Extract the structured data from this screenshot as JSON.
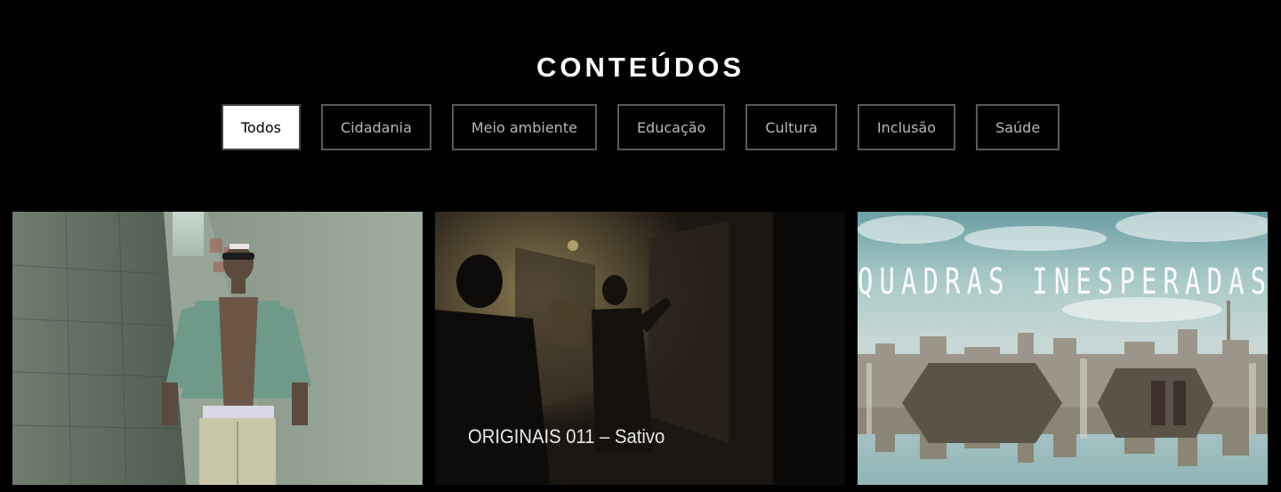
{
  "section": {
    "title": "CONTEÚDOS"
  },
  "filters": [
    {
      "label": "Todos",
      "active": true
    },
    {
      "label": "Cidadania",
      "active": false
    },
    {
      "label": "Meio ambiente",
      "active": false
    },
    {
      "label": "Educação",
      "active": false
    },
    {
      "label": "Cultura",
      "active": false
    },
    {
      "label": "Inclusão",
      "active": false
    },
    {
      "label": "Saúde",
      "active": false
    }
  ],
  "cards": [
    {
      "title": ""
    },
    {
      "title": "ORIGINAIS 011 – Sativo"
    },
    {
      "title": "",
      "banner_text": "QUADRAS INESPERADAS"
    }
  ],
  "colors": {
    "background": "#000000",
    "active_filter_bg": "#ffffff",
    "filter_border": "#5a5a5a",
    "filter_text": "#b8b8b8"
  }
}
